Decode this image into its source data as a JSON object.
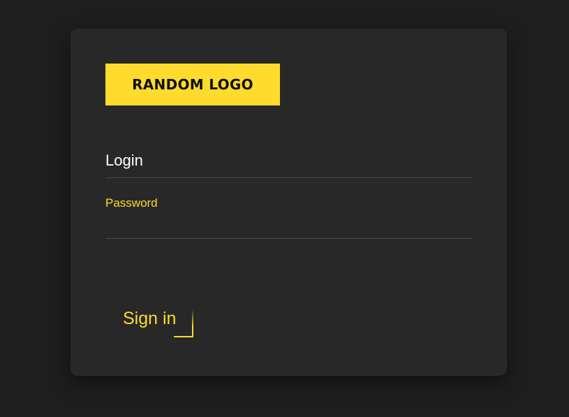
{
  "logo": {
    "text": "RANDOM LOGO"
  },
  "form": {
    "login_label": "Login",
    "login_value": "",
    "password_label": "Password",
    "password_value": "",
    "submit_label": "Sign in"
  },
  "colors": {
    "background": "#1e1e1e",
    "card": "#282828",
    "accent": "#ffdb2d",
    "divider": "#4a4a4a",
    "text": "#ffffff"
  }
}
